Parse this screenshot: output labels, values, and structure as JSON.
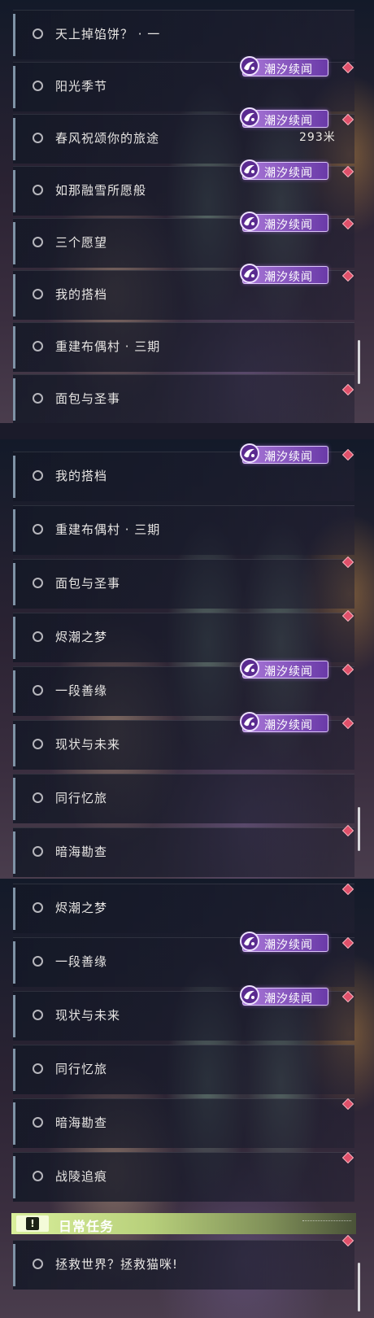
{
  "panel1": {
    "items": [
      {
        "label": "天上掉馅饼？ · 一"
      },
      {
        "label": "阳光季节"
      },
      {
        "label": "春风祝颂你的旅途",
        "distance": "293米"
      },
      {
        "label": "如那融雪所愿般"
      },
      {
        "label": "三个愿望"
      },
      {
        "label": "我的搭档"
      },
      {
        "label": "重建布偶村 · 三期"
      },
      {
        "label": "面包与圣事"
      }
    ]
  },
  "panel2": {
    "items": [
      {
        "label": "我的搭档"
      },
      {
        "label": "重建布偶村 · 三期"
      },
      {
        "label": "面包与圣事"
      },
      {
        "label": "烬潮之梦"
      },
      {
        "label": "一段善缘"
      },
      {
        "label": "现状与未来"
      },
      {
        "label": "同行忆旅"
      },
      {
        "label": "暗海勘查"
      }
    ]
  },
  "panel3": {
    "items": [
      {
        "label": "烬潮之梦"
      },
      {
        "label": "一段善缘"
      },
      {
        "label": "现状与未来"
      },
      {
        "label": "同行忆旅"
      },
      {
        "label": "暗海勘查"
      },
      {
        "label": "战陵追痕"
      }
    ],
    "section": {
      "title": "日常任务",
      "icon": "exclamation-icon"
    },
    "daily_items": [
      {
        "label": "拯救世界？拯救猫咪!"
      }
    ]
  },
  "badge": {
    "text": "潮汐续闻",
    "icon": "tide-swirl-icon"
  },
  "marker": {
    "icon": "red-diamond-marker-icon",
    "color": "#e0506a"
  },
  "colors": {
    "badge": "#8a55c4",
    "section": "#c7df86",
    "accent_bar": "#7f93a6"
  }
}
